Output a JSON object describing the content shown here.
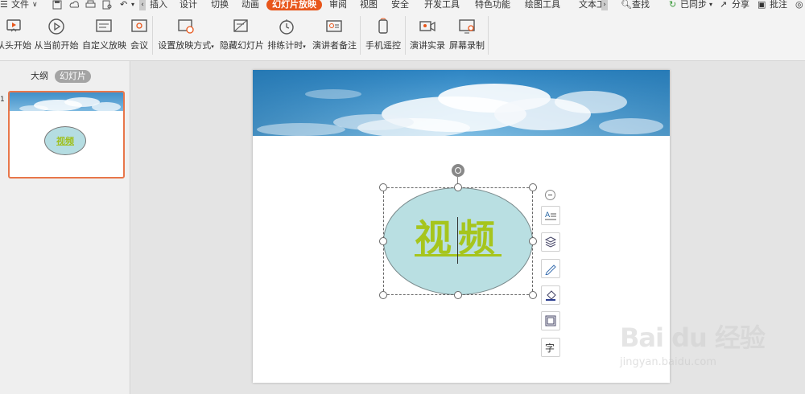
{
  "menubar": {
    "file_label": "文件",
    "tabs": [
      {
        "label": "插入",
        "active": false
      },
      {
        "label": "设计",
        "active": false
      },
      {
        "label": "切换",
        "active": false
      },
      {
        "label": "动画",
        "active": false
      },
      {
        "label": "幻灯片放映",
        "active": true
      },
      {
        "label": "审阅",
        "active": false
      },
      {
        "label": "视图",
        "active": false
      },
      {
        "label": "安全",
        "active": false
      },
      {
        "label": "开发工具",
        "active": false
      },
      {
        "label": "特色功能",
        "active": false
      },
      {
        "label": "绘图工具",
        "active": false
      },
      {
        "label": "文本工",
        "active": false
      }
    ],
    "search_label": "查找",
    "sync_label": "已同步",
    "share_label": "分享",
    "comment_label": "批注"
  },
  "ribbon": {
    "buttons": [
      {
        "label": "从头开始",
        "icon": "play-from-start-icon"
      },
      {
        "label": "从当前开始",
        "icon": "play-from-current-icon"
      },
      {
        "label": "自定义放映",
        "icon": "custom-show-icon"
      },
      {
        "label": "会议",
        "icon": "meeting-icon"
      },
      {
        "label": "设置放映方式",
        "icon": "setup-show-icon",
        "dropdown": true
      },
      {
        "label": "隐藏幻灯片",
        "icon": "hide-slide-icon"
      },
      {
        "label": "排练计时",
        "icon": "rehearse-timer-icon",
        "dropdown": true
      },
      {
        "label": "演讲者备注",
        "icon": "speaker-notes-icon"
      },
      {
        "label": "手机遥控",
        "icon": "phone-remote-icon"
      },
      {
        "label": "演讲实录",
        "icon": "record-presentation-icon"
      },
      {
        "label": "屏幕录制",
        "icon": "screen-record-icon"
      }
    ]
  },
  "left_panel": {
    "outline_tab": "大纲",
    "slides_tab": "幻灯片",
    "thumbnail": {
      "number": "1",
      "text": "视频"
    }
  },
  "slide": {
    "shape_text": "视频"
  },
  "colors": {
    "accent": "#e8561b",
    "shape_fill": "#b9dfe2",
    "shape_text": "#a6c51d"
  },
  "floating_toolbar": [
    {
      "icon": "text-format-icon"
    },
    {
      "icon": "layers-icon"
    },
    {
      "icon": "pen-icon"
    },
    {
      "icon": "fill-bucket-icon"
    },
    {
      "icon": "outline-icon"
    },
    {
      "icon": "font-icon"
    }
  ],
  "watermark": {
    "logo": "Bai du 经验",
    "url": "jingyan.baidu.com"
  }
}
